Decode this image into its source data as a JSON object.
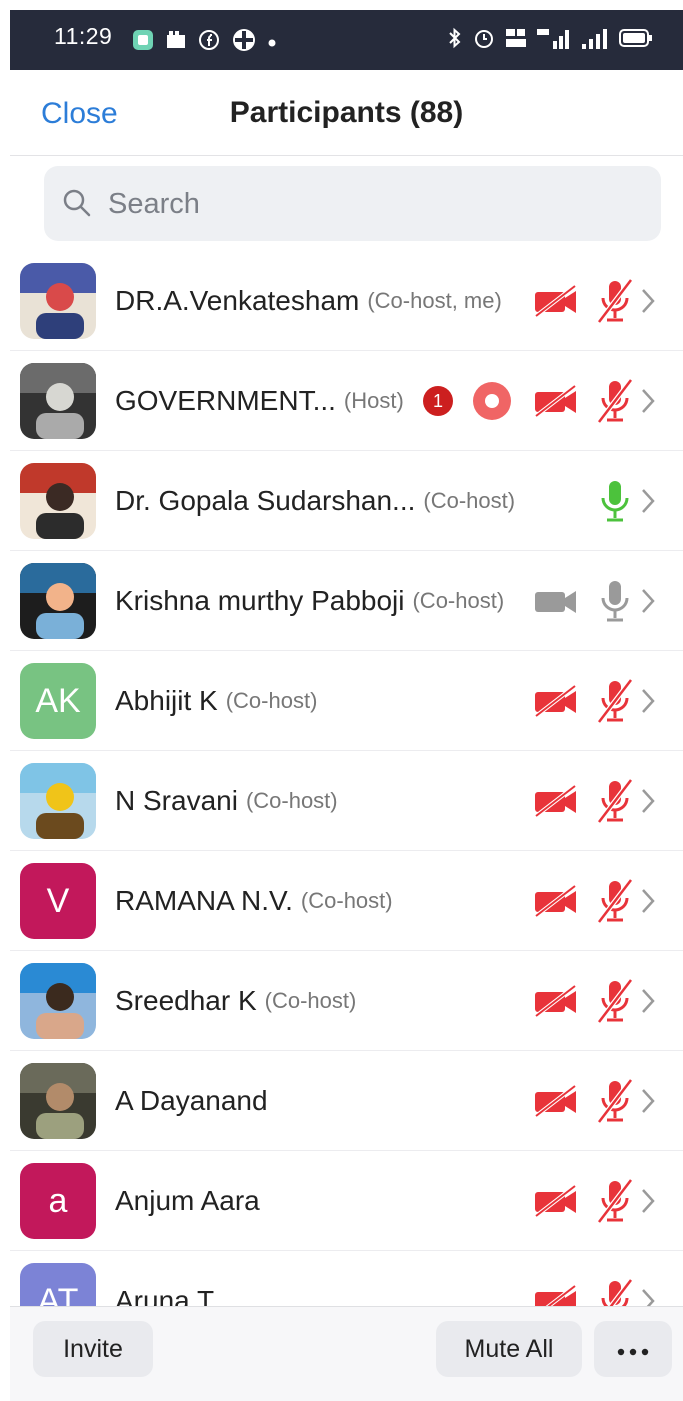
{
  "status_bar": {
    "time": "11:29",
    "left_icons": [
      "app-notification-icon",
      "gallery-icon",
      "facebook-icon",
      "game-icon",
      "dot-icon"
    ],
    "right_icons": [
      "bluetooth-icon",
      "alarm-icon",
      "volte-icon",
      "4g-signal-icon",
      "signal-icon",
      "battery-icon"
    ],
    "background": "#262b3b"
  },
  "nav": {
    "close_label": "Close",
    "title": "Participants (88)"
  },
  "search": {
    "placeholder": "Search",
    "value": ""
  },
  "participants": [
    {
      "name": "DR.A.Venkatesham",
      "role": "(Co-host, me)",
      "avatar": "photo",
      "video": "off",
      "mic": "off"
    },
    {
      "name": "GOVERNMENT...",
      "role": "(Host)",
      "avatar": "photo",
      "unread_badge": "1",
      "recording": true,
      "video": "off",
      "mic": "off"
    },
    {
      "name": "Dr. Gopala Sudarshan...",
      "role": "(Co-host)",
      "avatar": "photo",
      "video": "none",
      "mic": "on"
    },
    {
      "name": "Krishna murthy Pabboji",
      "role": "(Co-host)",
      "avatar": "photo",
      "video": "neutral",
      "mic": "neutral"
    },
    {
      "name": "Abhijit K",
      "role": "(Co-host)",
      "avatar_initials": "AK",
      "avatar_color": "#78c382",
      "video": "off",
      "mic": "off"
    },
    {
      "name": "N Sravani",
      "role": "(Co-host)",
      "avatar": "photo",
      "video": "off",
      "mic": "off"
    },
    {
      "name": "RAMANA N.V.",
      "role": "(Co-host)",
      "avatar_initials": "V",
      "avatar_color": "#c2185b",
      "video": "off",
      "mic": "off"
    },
    {
      "name": "Sreedhar K",
      "role": "(Co-host)",
      "avatar": "photo",
      "video": "off",
      "mic": "off"
    },
    {
      "name": "A Dayanand",
      "role": "",
      "avatar": "photo",
      "video": "off",
      "mic": "off"
    },
    {
      "name": "Anjum Aara",
      "role": "",
      "avatar_initials": "a",
      "avatar_color": "#c2185b",
      "video": "off",
      "mic": "off"
    },
    {
      "name": "Aruna T",
      "role": "",
      "avatar_initials": "AT",
      "avatar_color": "#7c83d6",
      "video": "off",
      "mic": "off"
    }
  ],
  "footer": {
    "invite_label": "Invite",
    "mute_all_label": "Mute All",
    "more_icon": "more-horizontal-icon"
  },
  "colors": {
    "accent_blue": "#2c7dd8",
    "muted_red": "#e8333a",
    "mic_on_green": "#4cc23c",
    "neutral_gray": "#9a9a9a"
  }
}
